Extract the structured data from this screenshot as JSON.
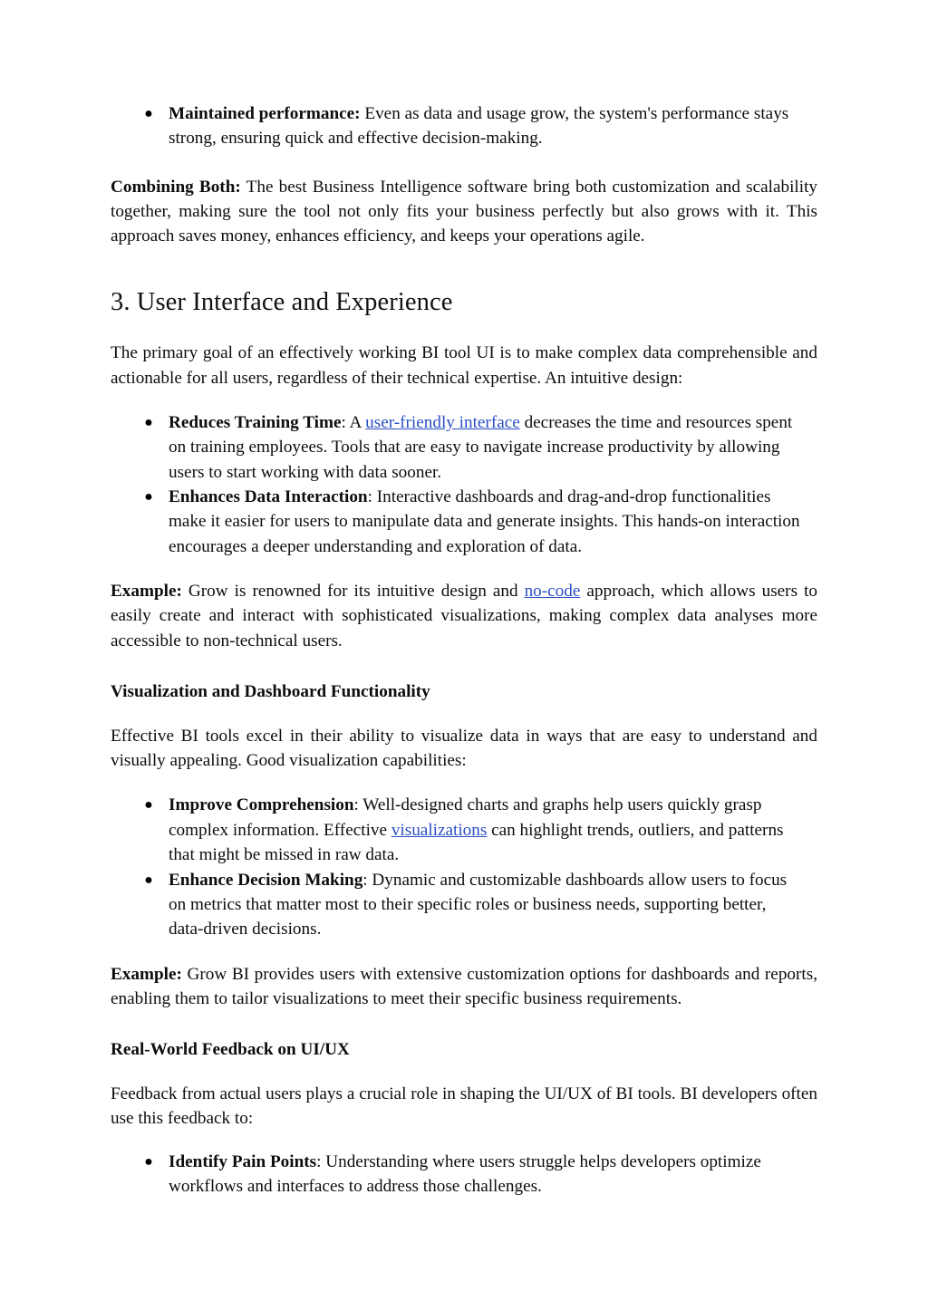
{
  "document": {
    "background_color": "#ffffff",
    "text_color": "#0d0d0d",
    "link_color": "#2b4ec4"
  },
  "blocks": {
    "maintained_performance": {
      "marker": "●",
      "term": "Maintained performance:",
      "body": " Even as data and usage grow, the system's performance stays strong, ensuring quick and effective decision-making."
    },
    "combining_both": {
      "term": "Combining Both:",
      "body": " The best Business Intelligence software bring both customization and scalability together, making sure the tool not only fits your business perfectly but also grows with it. This approach saves money, enhances efficiency, and keeps your operations agile."
    },
    "section_heading": "3. User Interface and Experience",
    "ui_intro": "The primary goal of an effectively working BI tool UI is to make complex data comprehensible and actionable for all users, regardless of their technical expertise. An intuitive design:",
    "ui_bullets": [
      {
        "marker": "●",
        "term": "Reduces Training Time",
        "pre": ": A ",
        "link": "user-friendly interface",
        "post": " decreases the time and resources spent on training employees. Tools that are easy to navigate increase productivity by allowing users to start working with data sooner."
      },
      {
        "marker": "●",
        "term": "Enhances Data Interaction",
        "pre": ": Interactive dashboards and drag-and-drop functionalities make it easier for users to manipulate data and generate insights. This hands-on interaction encourages a deeper understanding and exploration of data.",
        "link": "",
        "post": ""
      }
    ],
    "example_one": {
      "term": "Example:",
      "pre": " Grow is renowned for its intuitive design and ",
      "link": "no-code",
      "post": " approach, which allows users to easily create and interact with sophisticated visualizations, making complex data analyses more accessible to non-technical users."
    },
    "visualization_heading": "Visualization and Dashboard Functionality",
    "visualization_intro": "Effective BI tools excel in their ability to visualize data in ways that are easy to understand and visually appealing. Good visualization capabilities:",
    "visualization_bullets": [
      {
        "marker": "●",
        "term": "Improve Comprehension",
        "pre": ": Well-designed charts and graphs help users quickly grasp complex information. Effective ",
        "link": "visualizations",
        "post": " can highlight trends, outliers, and patterns that might be missed in raw data."
      },
      {
        "marker": "●",
        "term": "Enhance Decision Making",
        "pre": ": Dynamic and customizable dashboards allow users to focus on metrics that matter most to their specific roles or business needs, supporting better, data-driven decisions.",
        "link": "",
        "post": ""
      }
    ],
    "example_two": {
      "term": "Example:",
      "body": " Grow BI provides users with extensive customization options for dashboards and reports, enabling them to tailor visualizations to meet their specific business requirements."
    },
    "feedback_heading": "Real-World Feedback on UI/UX",
    "feedback_intro": "Feedback from actual users plays a crucial role in shaping the UI/UX of BI tools. BI developers often use this feedback to:",
    "feedback_bullets": [
      {
        "marker": "●",
        "term": "Identify Pain Points",
        "pre": ": Understanding where users struggle helps developers optimize workflows and interfaces to address those challenges.",
        "link": "",
        "post": ""
      }
    ]
  }
}
